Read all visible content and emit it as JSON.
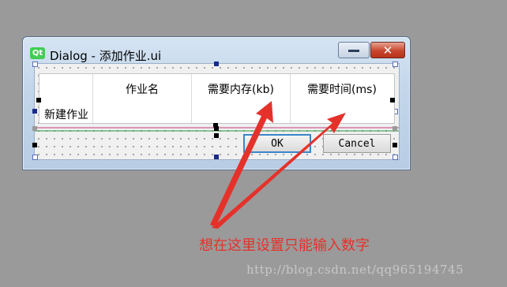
{
  "window": {
    "title": "Dialog - 添加作业.ui",
    "logo": "Qt",
    "minimize_icon": "minimize-icon",
    "close_symbol": "✕"
  },
  "table": {
    "columns": [
      "作业名",
      "需要内存(kb)",
      "需要时间(ms)"
    ],
    "row_header": "新建作业"
  },
  "buttons": {
    "ok_label": "OK",
    "cancel_label": "Cancel"
  },
  "annotation": {
    "text": "想在这里设置只能输入数字",
    "color": "#e4322b"
  },
  "watermark": "http://blog.csdn.net/qq965194745"
}
